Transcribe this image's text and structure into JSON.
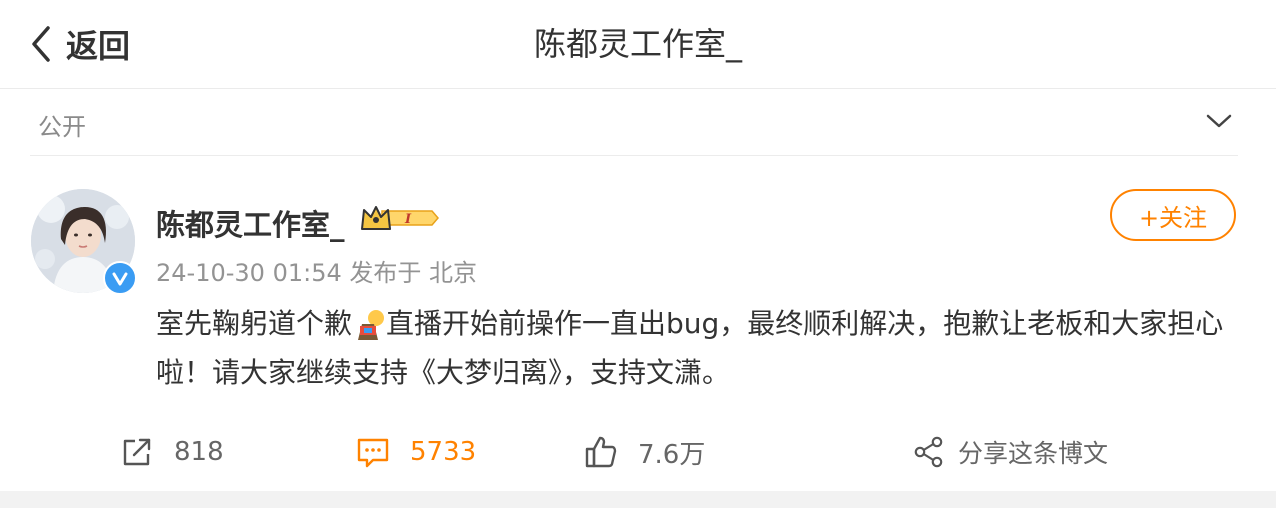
{
  "header": {
    "back_label": "返回",
    "title": "陈都灵工作室_"
  },
  "visibility": {
    "label": "公开"
  },
  "post": {
    "author": "陈都灵工作室_",
    "follow_label": "+关注",
    "timestamp": "24-10-30 01:54",
    "location": "发布于 北京",
    "content_part1": "室先鞠躬道个歉",
    "content_part2": "直播开始前操作一直出bug，最终顺利解决，抱歉让老板和大家担心啦！请大家继续支持《大梦归离》，支持文潇。"
  },
  "actions": {
    "repost_count": "818",
    "comment_count": "5733",
    "like_count": "7.6万",
    "share_label": "分享这条博文"
  },
  "icons": {
    "back": "chevron-left-icon",
    "dropdown": "chevron-down-icon",
    "verified": "verified-badge-icon",
    "member": "crown-badge-icon",
    "emoji": "bowing-emoji-icon",
    "repost": "repost-icon",
    "comment": "comment-icon",
    "like": "thumbs-up-icon",
    "share": "share-icon"
  },
  "colors": {
    "accent": "#ff8200",
    "verified": "#3a9cf3",
    "muted": "#939393"
  }
}
